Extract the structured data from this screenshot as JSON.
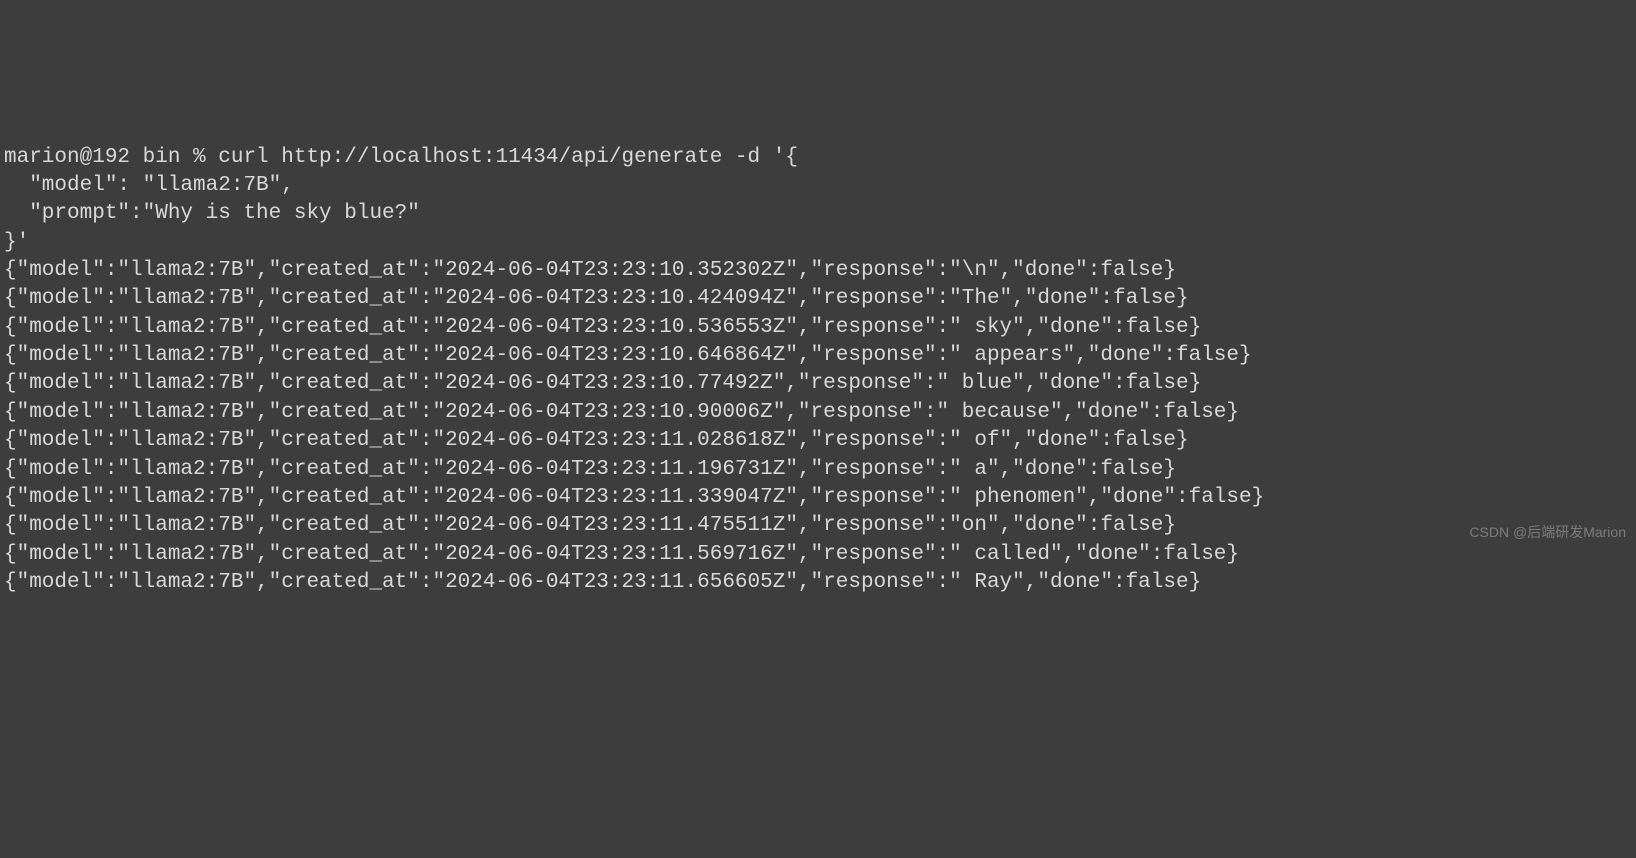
{
  "terminal": {
    "prompt_line": "marion@192 bin % curl http://localhost:11434/api/generate -d '{",
    "body_line1": "  \"model\": \"llama2:7B\",",
    "body_line2": "  \"prompt\":\"Why is the sky blue?\"",
    "body_line3": "}'",
    "responses": [
      "{\"model\":\"llama2:7B\",\"created_at\":\"2024-06-04T23:23:10.352302Z\",\"response\":\"\\n\",\"done\":false}",
      "{\"model\":\"llama2:7B\",\"created_at\":\"2024-06-04T23:23:10.424094Z\",\"response\":\"The\",\"done\":false}",
      "{\"model\":\"llama2:7B\",\"created_at\":\"2024-06-04T23:23:10.536553Z\",\"response\":\" sky\",\"done\":false}",
      "{\"model\":\"llama2:7B\",\"created_at\":\"2024-06-04T23:23:10.646864Z\",\"response\":\" appears\",\"done\":false}",
      "{\"model\":\"llama2:7B\",\"created_at\":\"2024-06-04T23:23:10.77492Z\",\"response\":\" blue\",\"done\":false}",
      "{\"model\":\"llama2:7B\",\"created_at\":\"2024-06-04T23:23:10.90006Z\",\"response\":\" because\",\"done\":false}",
      "{\"model\":\"llama2:7B\",\"created_at\":\"2024-06-04T23:23:11.028618Z\",\"response\":\" of\",\"done\":false}",
      "{\"model\":\"llama2:7B\",\"created_at\":\"2024-06-04T23:23:11.196731Z\",\"response\":\" a\",\"done\":false}",
      "{\"model\":\"llama2:7B\",\"created_at\":\"2024-06-04T23:23:11.339047Z\",\"response\":\" phenomen\",\"done\":false}",
      "{\"model\":\"llama2:7B\",\"created_at\":\"2024-06-04T23:23:11.475511Z\",\"response\":\"on\",\"done\":false}",
      "{\"model\":\"llama2:7B\",\"created_at\":\"2024-06-04T23:23:11.569716Z\",\"response\":\" called\",\"done\":false}",
      "{\"model\":\"llama2:7B\",\"created_at\":\"2024-06-04T23:23:11.656605Z\",\"response\":\" Ray\",\"done\":false}"
    ]
  },
  "watermark": "CSDN @后端研发Marion"
}
